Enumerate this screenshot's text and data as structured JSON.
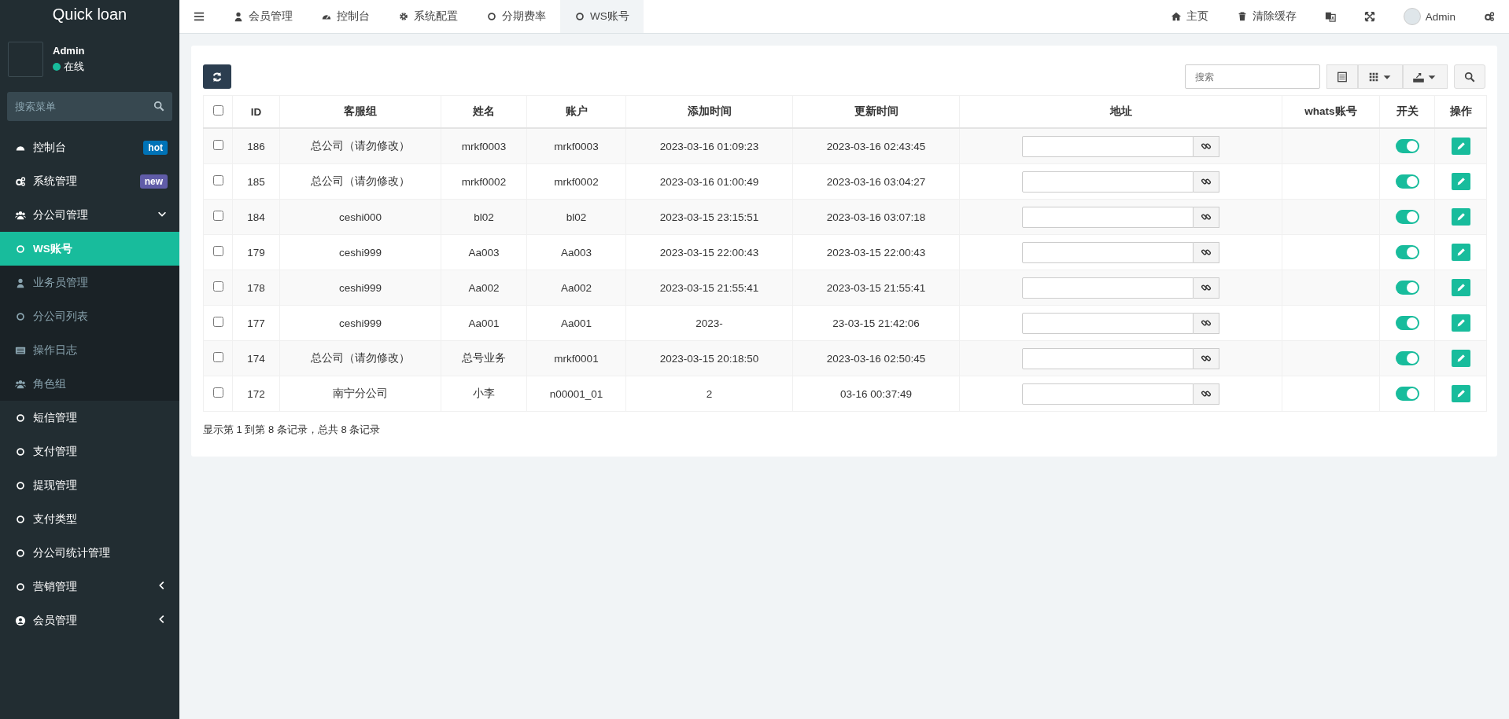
{
  "sidebar": {
    "logo": "Quick loan",
    "user": {
      "name": "Admin",
      "status": "在线",
      "online": true
    },
    "search_placeholder": "搜索菜单",
    "items": [
      {
        "label": "控制台",
        "kind": "dashboard",
        "selected": false,
        "badge": {
          "text": "hot",
          "color": "#0073b7"
        }
      },
      {
        "label": "系统管理",
        "kind": "gears",
        "selected": false,
        "badge": {
          "text": "new",
          "color": "#605ca8"
        }
      },
      {
        "label": "分公司管理",
        "kind": "users",
        "selected": false,
        "expanded": true,
        "children": [
          {
            "label": "WS账号",
            "kind": "circle",
            "selected": true
          },
          {
            "label": "业务员管理",
            "kind": "user",
            "selected": false
          },
          {
            "label": "分公司列表",
            "kind": "circle",
            "selected": false
          },
          {
            "label": "操作日志",
            "kind": "list",
            "selected": false
          },
          {
            "label": "角色组",
            "kind": "users",
            "selected": false
          }
        ]
      },
      {
        "label": "短信管理",
        "kind": "circle",
        "selected": false
      },
      {
        "label": "支付管理",
        "kind": "circle",
        "selected": false
      },
      {
        "label": "提现管理",
        "kind": "circle",
        "selected": false
      },
      {
        "label": "支付类型",
        "kind": "circle",
        "selected": false
      },
      {
        "label": "分公司统计管理",
        "kind": "circle",
        "selected": false
      },
      {
        "label": "营销管理",
        "kind": "circle",
        "selected": false,
        "expanded": false
      },
      {
        "label": "会员管理",
        "kind": "user-circle",
        "selected": false,
        "expanded": false
      }
    ]
  },
  "topbar": {
    "tabs": [
      {
        "label": "会员管理",
        "kind": "user",
        "selected": false
      },
      {
        "label": "控制台",
        "kind": "dashboard",
        "selected": false
      },
      {
        "label": "系统配置",
        "kind": "gear",
        "selected": false
      },
      {
        "label": "分期费率",
        "kind": "circle",
        "selected": false
      },
      {
        "label": "WS账号",
        "kind": "circle",
        "selected": true
      }
    ],
    "right": [
      {
        "label": "主页",
        "kind": "home"
      },
      {
        "label": "清除缓存",
        "kind": "trash"
      },
      {
        "kind": "translate"
      },
      {
        "kind": "expand"
      },
      {
        "label": "Admin",
        "kind": "avatar"
      },
      {
        "kind": "gears"
      }
    ]
  },
  "toolbar": {
    "search_placeholder": "搜索"
  },
  "table": {
    "header_checked": false,
    "columns": [
      "ID",
      "客服组",
      "姓名",
      "账户",
      "添加时间",
      "更新时间",
      "地址",
      "whats账号",
      "开关",
      "操作"
    ],
    "rows": [
      {
        "checked": false,
        "id": "186",
        "group": "总公司（请勿修改）",
        "name": "mrkf0003",
        "account": "mrkf0003",
        "added": "2023-03-16 01:09:23",
        "updated": "2023-03-16 02:43:45",
        "switch_on": true
      },
      {
        "checked": false,
        "id": "185",
        "group": "总公司（请勿修改）",
        "name": "mrkf0002",
        "account": "mrkf0002",
        "added": "2023-03-16 01:00:49",
        "updated": "2023-03-16 03:04:27",
        "switch_on": true
      },
      {
        "checked": false,
        "id": "184",
        "group": "ceshi000",
        "name": "bl02",
        "account": "bl02",
        "added": "2023-03-15 23:15:51",
        "updated": "2023-03-16 03:07:18",
        "switch_on": true
      },
      {
        "checked": false,
        "id": "179",
        "group": "ceshi999",
        "name": "Aa003",
        "account": "Aa003",
        "added": "2023-03-15 22:00:43",
        "updated": "2023-03-15 22:00:43",
        "switch_on": true
      },
      {
        "checked": false,
        "id": "178",
        "group": "ceshi999",
        "name": "Aa002",
        "account": "Aa002",
        "added": "2023-03-15 21:55:41",
        "updated": "2023-03-15 21:55:41",
        "switch_on": true
      },
      {
        "checked": false,
        "id": "177",
        "group": "ceshi999",
        "name": "Aa001",
        "account": "Aa001",
        "added": "2023-",
        "updated": "23-03-15 21:42:06",
        "switch_on": true
      },
      {
        "checked": false,
        "id": "174",
        "group": "总公司（请勿修改）",
        "name": "总号业务",
        "account": "mrkf0001",
        "added": "2023-03-15 20:18:50",
        "updated": "2023-03-16 02:50:45",
        "switch_on": true
      },
      {
        "checked": false,
        "id": "172",
        "group": "南宁分公司",
        "name": "小李",
        "account": "n00001_01",
        "added": "2",
        "updated": "03-16 00:37:49",
        "switch_on": true
      }
    ]
  },
  "footer": "显示第 1 到第 8 条记录，总共 8 条记录"
}
